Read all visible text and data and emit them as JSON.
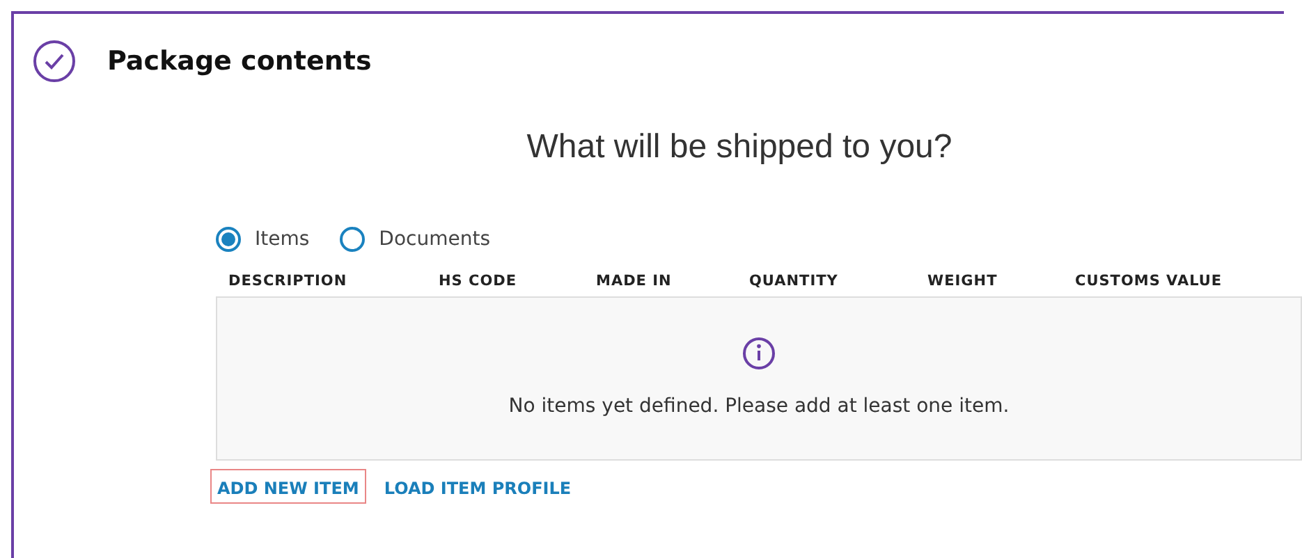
{
  "section": {
    "title": "Package contents",
    "completed": true
  },
  "question": "What will be shipped to you?",
  "shipment_type": [
    {
      "label": "Items",
      "selected": true
    },
    {
      "label": "Documents",
      "selected": false
    }
  ],
  "table": {
    "columns": [
      "DESCRIPTION",
      "HS CODE",
      "MADE IN",
      "QUANTITY",
      "WEIGHT",
      "CUSTOMS VALUE"
    ],
    "empty_message": "No items yet defined. Please add at least one item."
  },
  "actions": [
    {
      "label": "ADD NEW ITEM",
      "focused": true
    },
    {
      "label": "LOAD ITEM PROFILE",
      "focused": false
    }
  ]
}
